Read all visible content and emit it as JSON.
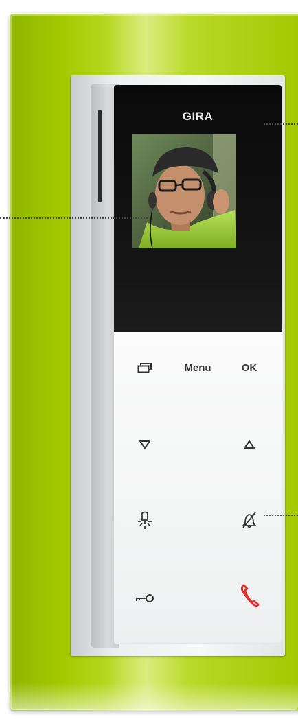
{
  "device": {
    "brand": "GIRA",
    "frame_color": "#a5c900"
  },
  "keypad": {
    "row1": {
      "left_icon": "screens-icon",
      "center_label": "Menu",
      "right_label": "OK"
    },
    "row2": {
      "left_icon": "down-triangle-icon",
      "right_icon": "up-triangle-icon"
    },
    "row3": {
      "left_icon": "light-bulb-icon",
      "right_icon": "mute-bell-icon"
    },
    "row4": {
      "left_icon": "key-icon",
      "right_icon": "handset-icon"
    },
    "handset_color": "#e03030"
  }
}
